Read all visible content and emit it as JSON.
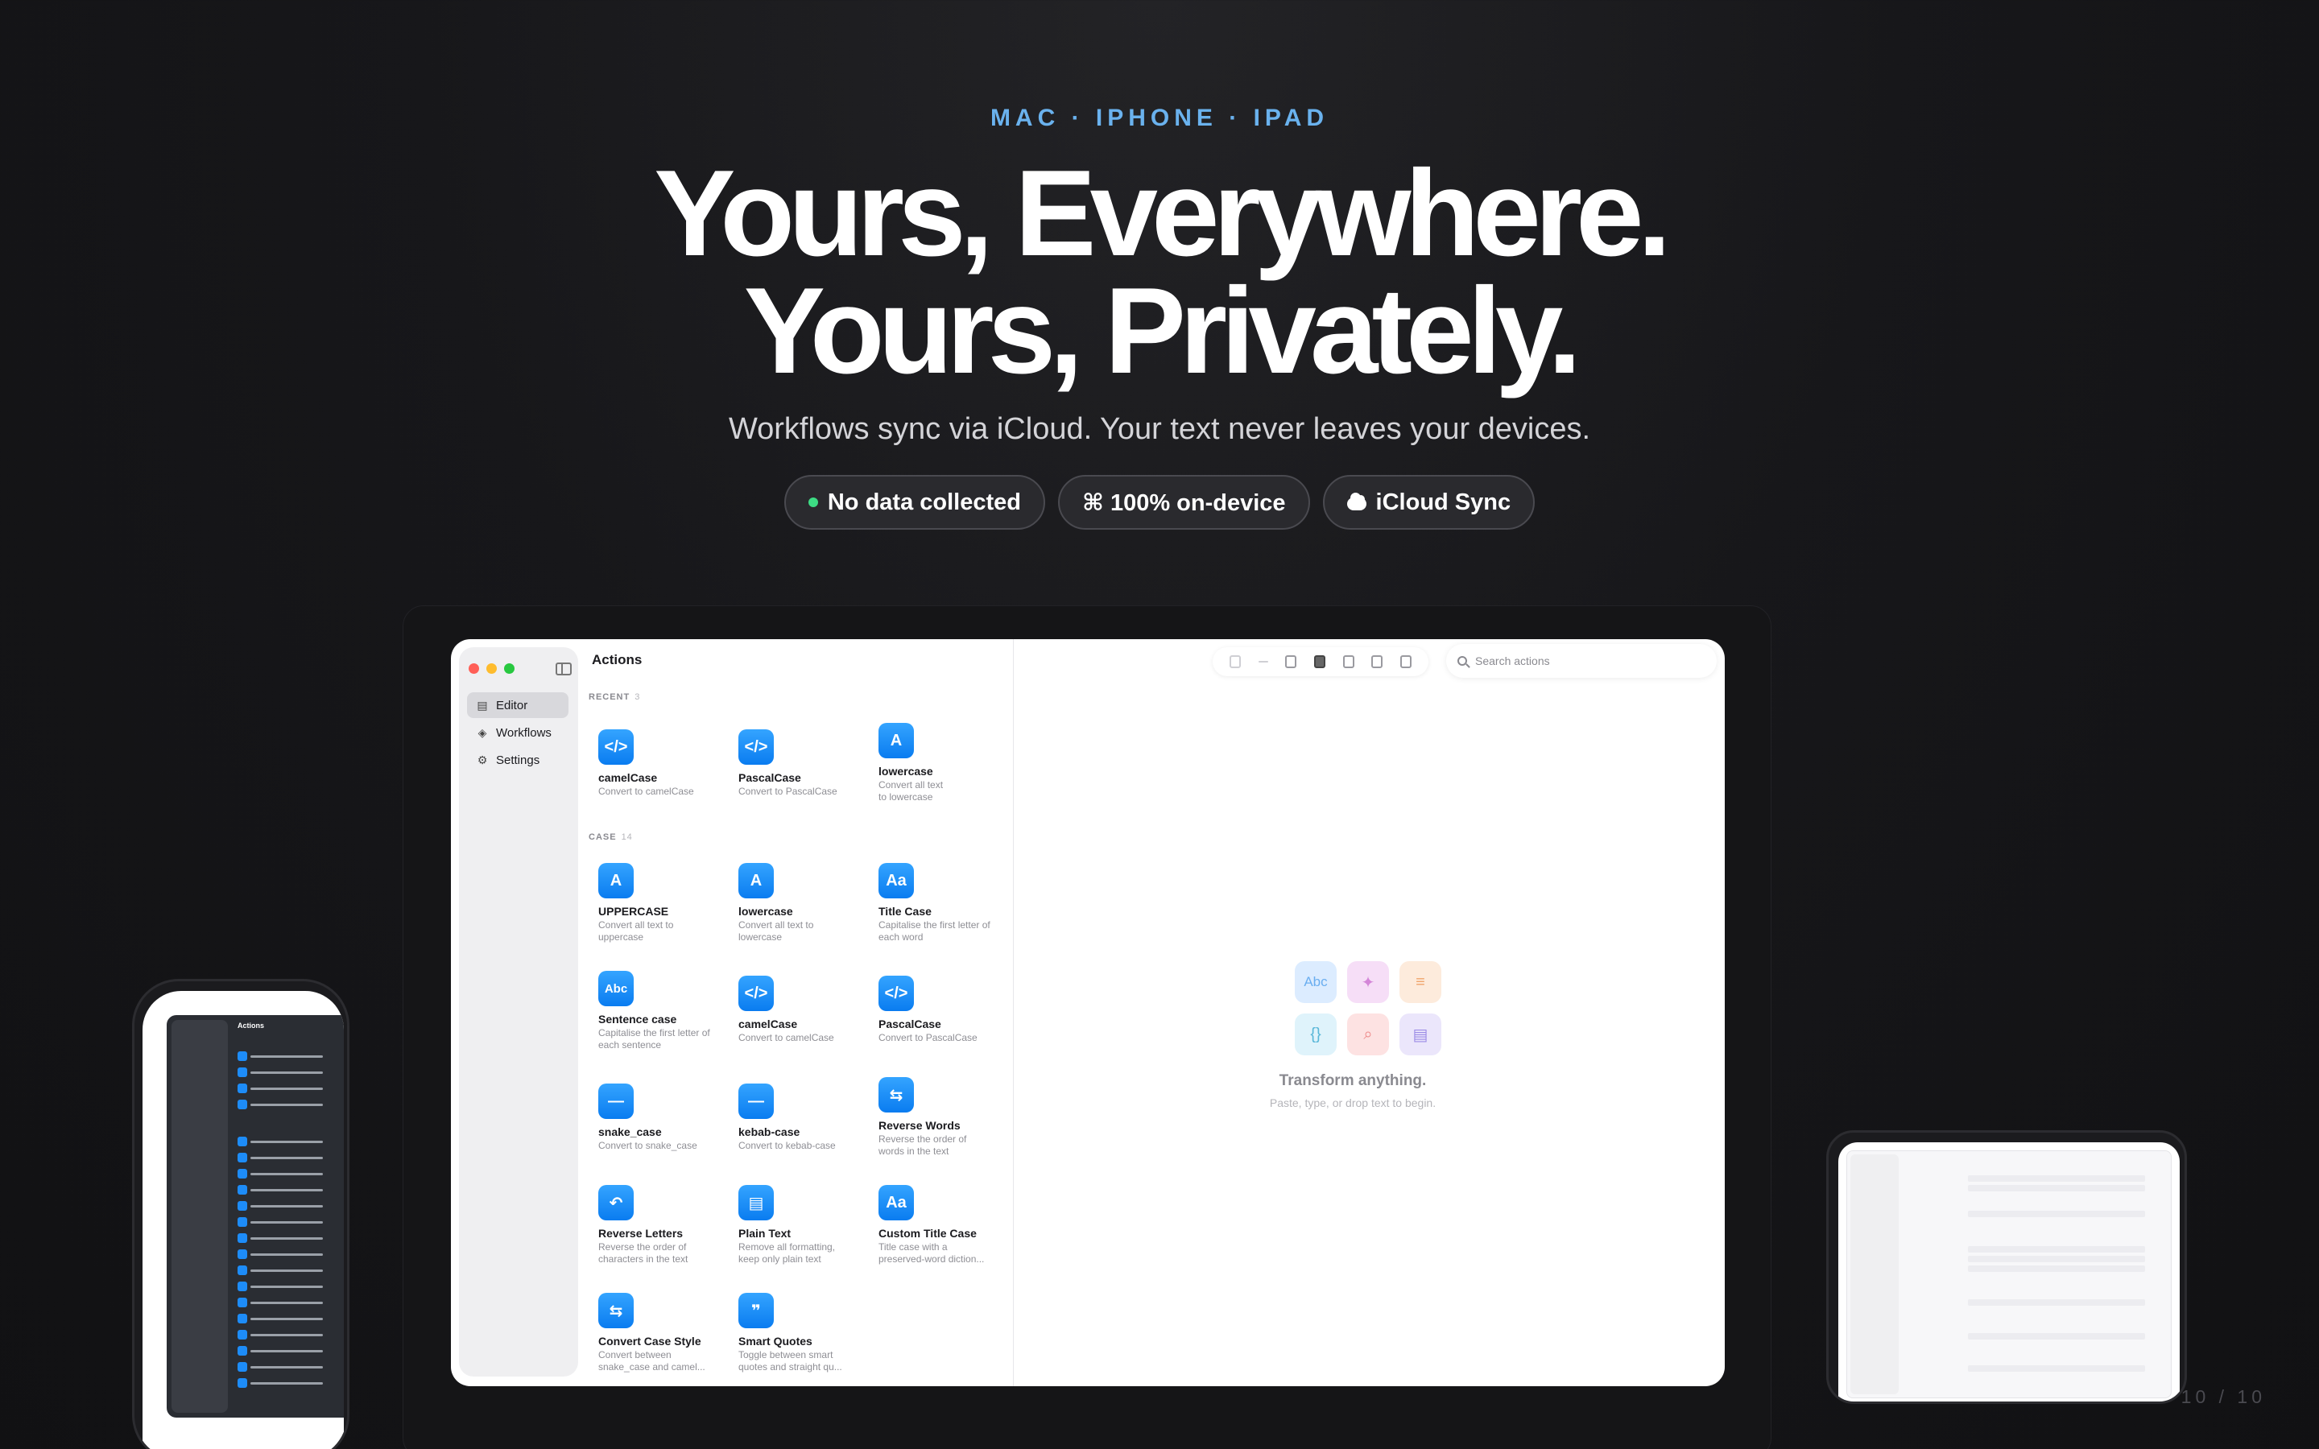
{
  "hero": {
    "kicker": "MAC · IPHONE · IPAD",
    "headline_line1": "Yours, Everywhere.",
    "headline_line2": "Yours, Privately.",
    "subhead": "Workflows sync via iCloud. Your text never leaves your devices."
  },
  "pills": [
    {
      "icon": "green-dot",
      "label": "No data collected"
    },
    {
      "icon": "command-icon",
      "label": "⌘ 100% on-device"
    },
    {
      "icon": "cloud-icon",
      "label": "iCloud Sync"
    }
  ],
  "mac_app": {
    "title": "Actions",
    "nav": [
      "Editor",
      "Workflows",
      "Settings"
    ],
    "search_placeholder": "Search actions",
    "recent": {
      "label": "RECENT",
      "count": "3"
    },
    "case": {
      "label": "CASE",
      "count": "14"
    },
    "recent_items": [
      {
        "icon_text": "</>",
        "name": "camelCase",
        "desc": "Convert to camelCase"
      },
      {
        "icon_text": "</>",
        "name": "PascalCase",
        "desc": "Convert to PascalCase"
      },
      {
        "icon_text": "A",
        "name": "lowercase",
        "desc": "Convert all text to lowercase"
      }
    ],
    "case_items": [
      {
        "icon_text": "A",
        "name": "UPPERCASE",
        "desc": "Convert all text to uppercase"
      },
      {
        "icon_text": "A",
        "name": "lowercase",
        "desc": "Convert all text to lowercase"
      },
      {
        "icon_text": "Aa",
        "name": "Title Case",
        "desc": "Capitalise the first letter of each word"
      },
      {
        "icon_text": "Abc",
        "name": "Sentence case",
        "desc": "Capitalise the first letter of each sentence"
      },
      {
        "icon_text": "</>",
        "name": "camelCase",
        "desc": "Convert to camelCase"
      },
      {
        "icon_text": "</>",
        "name": "PascalCase",
        "desc": "Convert to PascalCase"
      },
      {
        "icon_text": "—",
        "name": "snake_case",
        "desc": "Convert to snake_case"
      },
      {
        "icon_text": "—",
        "name": "kebab-case",
        "desc": "Convert to kebab-case"
      },
      {
        "icon_text": "⇆",
        "name": "Reverse Words",
        "desc": "Reverse the order of words in the text"
      },
      {
        "icon_text": "↶",
        "name": "Reverse Letters",
        "desc": "Reverse the order of characters in the text"
      },
      {
        "icon_text": "▤",
        "name": "Plain Text",
        "desc": "Remove all formatting, keep only plain text"
      },
      {
        "icon_text": "Aa",
        "name": "Custom Title Case",
        "desc": "Title case with a preserved-word diction..."
      },
      {
        "icon_text": "⇆",
        "name": "Convert Case Style",
        "desc": "Convert between snake_case and camel..."
      },
      {
        "icon_text": "❞",
        "name": "Smart Quotes",
        "desc": "Toggle between smart quotes and straight qu..."
      }
    ],
    "empty_state": {
      "title": "Transform anything.",
      "subtitle": "Paste, type, or drop text to begin.",
      "icons": [
        "Abc",
        "✦",
        "≡",
        "{}",
        "⌕",
        "▤"
      ],
      "icon_colors": [
        "#dcecff",
        "#f6def7",
        "#fdebdc",
        "#dff3fb",
        "#fde2e2",
        "#ebe6fb"
      ],
      "icon_fg": [
        "#6aaef0",
        "#d486d8",
        "#f0a46c",
        "#58b7d8",
        "#ee8a8a",
        "#9c8ce6"
      ]
    }
  },
  "phone_app": {
    "title": "Actions"
  },
  "pager": "10 / 10",
  "colors": {
    "accent": "#6ab2ee",
    "icon_blue": "#1d8cf8",
    "traffic": [
      "#ff5f57",
      "#febc2e",
      "#28c840"
    ]
  }
}
